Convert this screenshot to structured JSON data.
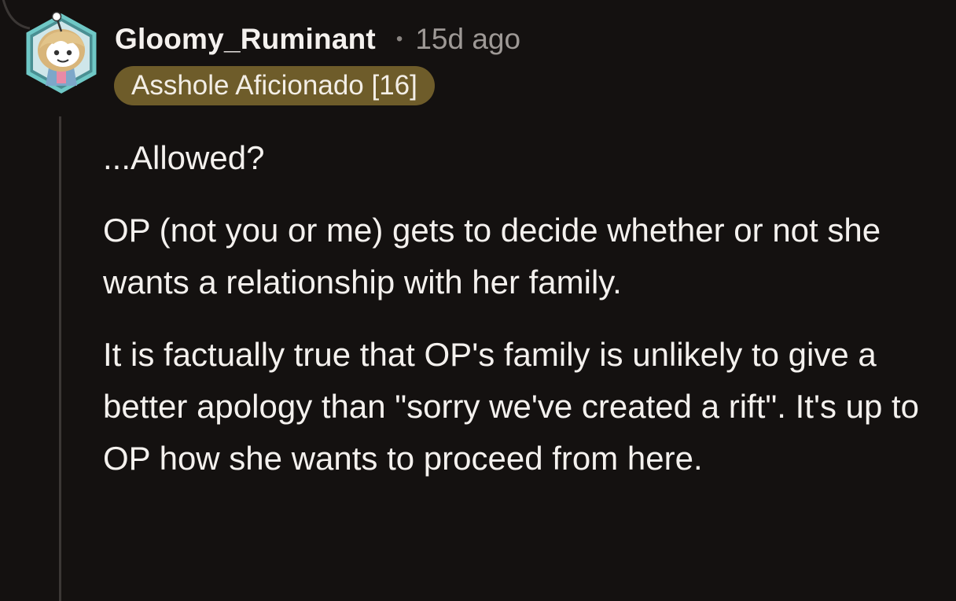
{
  "comment": {
    "username": "Gloomy_Ruminant",
    "separator": "•",
    "timestamp": "15d ago",
    "flair": "Asshole Aficionado [16]",
    "paragraphs": [
      "...Allowed?",
      "OP (not you or me) gets to decide whether or not she wants a relationship with her family.",
      "It is factually true that OP's family is unlikely to give a better apology than \"sorry we've created a rift\". It's up to OP how she wants to proceed from here."
    ]
  },
  "colors": {
    "background": "#141110",
    "flair_background": "#6e5c2a",
    "thread_line": "#3b3735",
    "text": "#f4f1ee",
    "muted_text": "#9e9996"
  },
  "icons": {
    "avatar": "snoo-avatar-icon"
  }
}
